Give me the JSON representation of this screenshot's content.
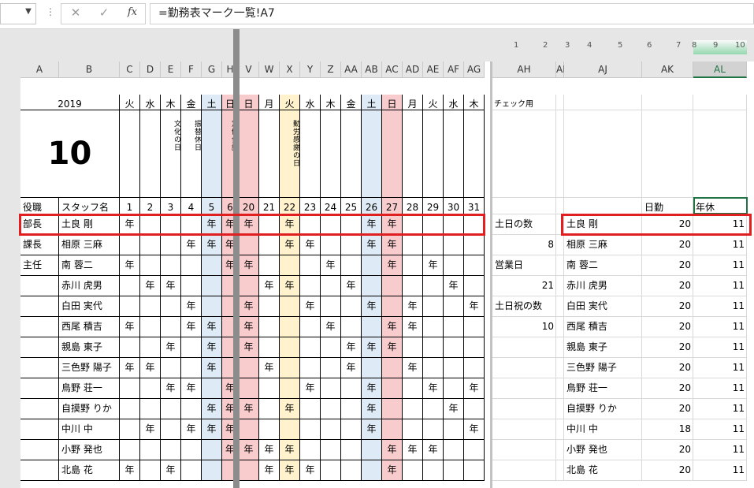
{
  "formula_bar": {
    "formula": "=勤務表マーク一覧!A7",
    "cancel_icon": "✕",
    "enter_icon": "✓",
    "fx_label": "fx"
  },
  "outline_levels": [
    "1",
    "2",
    "3",
    "4",
    "5",
    "6",
    "7",
    "8",
    "9",
    "10"
  ],
  "columns": [
    "A",
    "B",
    "C",
    "D",
    "E",
    "F",
    "G",
    "H",
    "V",
    "W",
    "X",
    "Y",
    "Z",
    "AA",
    "AB",
    "AC",
    "AD",
    "AE",
    "AF",
    "AG",
    "AH",
    "AI",
    "AJ",
    "AK",
    "AL"
  ],
  "schedule": {
    "year": "2019",
    "month": "10",
    "days": [
      "1",
      "2",
      "3",
      "4",
      "5",
      "6",
      "20",
      "21",
      "22",
      "23",
      "24",
      "25",
      "26",
      "27",
      "28",
      "29",
      "30",
      "31"
    ],
    "weekdays": [
      "火",
      "水",
      "木",
      "金",
      "土",
      "日",
      "日",
      "月",
      "火",
      "水",
      "木",
      "金",
      "土",
      "日",
      "月",
      "火",
      "水",
      "木"
    ],
    "holiday_notes": [
      "",
      "",
      "文化の日",
      "振替休日",
      "",
      "定例会議",
      "",
      "",
      "勤労感謝の日",
      "",
      "",
      "",
      "",
      "",
      "",
      "",
      "",
      ""
    ],
    "header_role": "役職",
    "header_staff": "スタッフ名",
    "leave_mark": "年",
    "rows": [
      {
        "role": "部長",
        "name": "土良 剛",
        "marks": [
          1,
          0,
          0,
          0,
          1,
          1,
          1,
          0,
          1,
          0,
          0,
          0,
          1,
          1,
          0,
          0,
          0,
          0
        ]
      },
      {
        "role": "課長",
        "name": "相原 三麻",
        "marks": [
          0,
          0,
          0,
          1,
          1,
          1,
          0,
          0,
          1,
          1,
          0,
          0,
          1,
          1,
          0,
          0,
          0,
          0
        ]
      },
      {
        "role": "主任",
        "name": "南 蓉二",
        "marks": [
          1,
          0,
          0,
          0,
          0,
          1,
          1,
          0,
          0,
          0,
          1,
          0,
          0,
          1,
          0,
          1,
          0,
          0
        ]
      },
      {
        "role": "",
        "name": "赤川 虎男",
        "marks": [
          0,
          1,
          1,
          0,
          0,
          0,
          0,
          1,
          1,
          0,
          0,
          1,
          0,
          0,
          0,
          0,
          1,
          0
        ]
      },
      {
        "role": "",
        "name": "白田 実代",
        "marks": [
          0,
          0,
          0,
          1,
          0,
          0,
          1,
          0,
          0,
          1,
          0,
          0,
          1,
          0,
          1,
          0,
          0,
          1
        ]
      },
      {
        "role": "",
        "name": "西尾 積吉",
        "marks": [
          1,
          0,
          0,
          1,
          1,
          0,
          1,
          0,
          0,
          0,
          1,
          0,
          0,
          1,
          1,
          0,
          0,
          0
        ]
      },
      {
        "role": "",
        "name": "親島 東子",
        "marks": [
          0,
          0,
          1,
          0,
          1,
          0,
          1,
          0,
          0,
          0,
          0,
          1,
          1,
          1,
          0,
          0,
          0,
          0
        ]
      },
      {
        "role": "",
        "name": "三色野 陽子",
        "marks": [
          1,
          1,
          0,
          0,
          1,
          0,
          0,
          1,
          0,
          0,
          0,
          1,
          0,
          0,
          1,
          0,
          0,
          0
        ]
      },
      {
        "role": "",
        "name": "鳥野 荘一",
        "marks": [
          0,
          0,
          1,
          1,
          0,
          1,
          0,
          0,
          0,
          1,
          0,
          0,
          1,
          0,
          0,
          1,
          0,
          1
        ]
      },
      {
        "role": "",
        "name": "自摸野 りか",
        "marks": [
          0,
          0,
          0,
          0,
          1,
          1,
          1,
          0,
          1,
          0,
          0,
          0,
          1,
          0,
          0,
          0,
          1,
          0
        ]
      },
      {
        "role": "",
        "name": "中川 中",
        "marks": [
          0,
          1,
          0,
          1,
          1,
          1,
          0,
          0,
          0,
          0,
          0,
          0,
          1,
          0,
          0,
          0,
          0,
          1
        ]
      },
      {
        "role": "",
        "name": "小野 発也",
        "marks": [
          0,
          0,
          0,
          0,
          0,
          1,
          1,
          1,
          1,
          0,
          0,
          0,
          0,
          1,
          1,
          1,
          0,
          0
        ]
      },
      {
        "role": "",
        "name": "北島 花",
        "marks": [
          1,
          0,
          1,
          0,
          0,
          0,
          0,
          1,
          1,
          1,
          0,
          0,
          0,
          1,
          0,
          0,
          0,
          0
        ]
      }
    ]
  },
  "check": {
    "title": "チェック用",
    "col_workdays": "日勤",
    "col_annual": "年休",
    "stats": [
      {
        "label": "土日の数",
        "value": ""
      },
      {
        "label": "",
        "value": "8"
      },
      {
        "label": "営業日",
        "value": ""
      },
      {
        "label": "",
        "value": "21"
      },
      {
        "label": "土日祝の数",
        "value": ""
      },
      {
        "label": "",
        "value": "10"
      }
    ],
    "staff": [
      {
        "name": "土良 剛",
        "work": "20",
        "annual": "11"
      },
      {
        "name": "相原 三麻",
        "work": "20",
        "annual": "11"
      },
      {
        "name": "南 蓉二",
        "work": "20",
        "annual": "11"
      },
      {
        "name": "赤川 虎男",
        "work": "20",
        "annual": "11"
      },
      {
        "name": "白田 実代",
        "work": "20",
        "annual": "11"
      },
      {
        "name": "西尾 積吉",
        "work": "20",
        "annual": "11"
      },
      {
        "name": "親島 東子",
        "work": "20",
        "annual": "11"
      },
      {
        "name": "三色野 陽子",
        "work": "20",
        "annual": "11"
      },
      {
        "name": "鳥野 荘一",
        "work": "20",
        "annual": "11"
      },
      {
        "name": "自摸野 りか",
        "work": "20",
        "annual": "11"
      },
      {
        "name": "中川 中",
        "work": "18",
        "annual": "11"
      },
      {
        "name": "小野 発也",
        "work": "20",
        "annual": "11"
      },
      {
        "name": "北島 花",
        "work": "20",
        "annual": "11"
      }
    ]
  }
}
